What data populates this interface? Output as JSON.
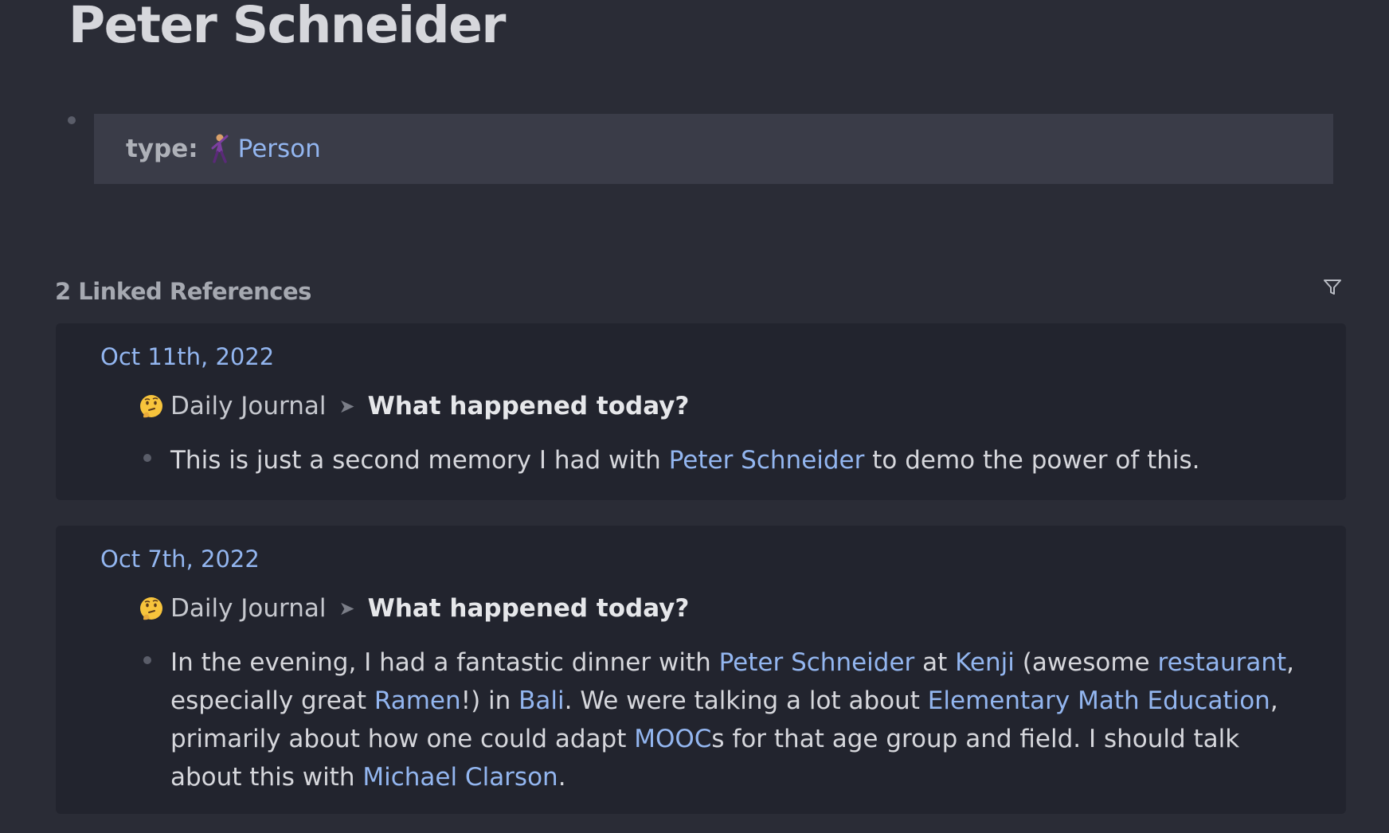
{
  "page": {
    "title": "Peter Schneider"
  },
  "properties": {
    "type_key": "type:",
    "type_emoji_icon": "dancing-person-emoji",
    "type_value": "Person"
  },
  "linked_references": {
    "title": "2 Linked References",
    "filter_icon": "filter-icon",
    "groups": [
      {
        "date": "Oct 11th, 2022",
        "breadcrumb": {
          "emoji_icon": "thinking-face-emoji",
          "parent": "Daily Journal",
          "separator": "➤",
          "current": "What happened today?"
        },
        "block": {
          "t1": "This is just a second memory I had with ",
          "link1": "Peter Schneider",
          "t2": " to demo the power of this."
        }
      },
      {
        "date": "Oct 7th, 2022",
        "breadcrumb": {
          "emoji_icon": "thinking-face-emoji",
          "parent": "Daily Journal",
          "separator": "➤",
          "current": "What happened today?"
        },
        "block": {
          "t1": "In the evening, I had a fantastic dinner with ",
          "link1": "Peter Schneider",
          "t2": " at ",
          "link2": "Kenji",
          "t3": " (awesome ",
          "link3": "restaurant",
          "t4": ", especially great ",
          "link4": "Ramen",
          "t5": "!) in ",
          "link5": "Bali",
          "t6": ". We were talking a lot about ",
          "link6": "Elementary Math Education",
          "t7": ", primarily about how one could adapt ",
          "link7": "MOOC",
          "t8": "s for that age group and field. I should talk about this with ",
          "link8": "Michael Clarson",
          "t9": "."
        }
      }
    ]
  },
  "colors": {
    "background": "#2a2c36",
    "card_background": "#22242e",
    "property_background": "#3a3c48",
    "link": "#93b6f0",
    "text": "#d6d7dc"
  }
}
